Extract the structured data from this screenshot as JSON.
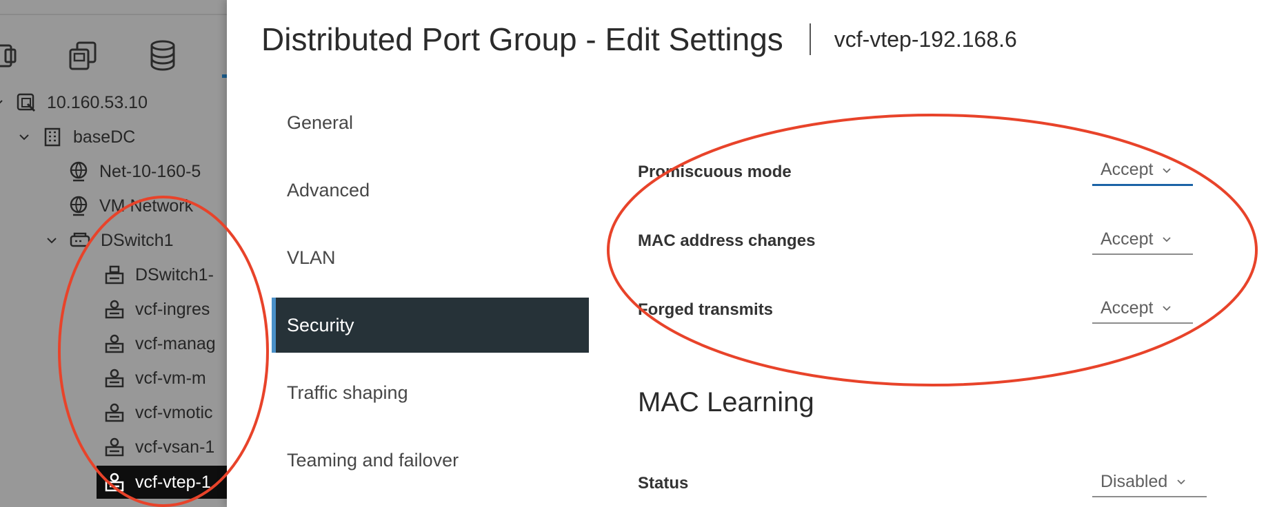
{
  "inventory": {
    "toolbar": [
      {
        "icon": "vms-templates-icon"
      },
      {
        "icon": "copy-icon"
      },
      {
        "icon": "database-icon"
      }
    ],
    "tree": [
      {
        "label": "10.160.53.10",
        "icon": "vcenter-icon",
        "expanded": true
      },
      {
        "label": "baseDC",
        "icon": "datacenter-icon",
        "expanded": true
      },
      {
        "label": "Net-10-160-5",
        "icon": "network-icon"
      },
      {
        "label": "VM Network",
        "icon": "network-icon"
      },
      {
        "label": "DSwitch1",
        "icon": "distributed-switch-icon",
        "expanded": true
      },
      {
        "label": "DSwitch1-",
        "icon": "uplink-portgroup-icon"
      },
      {
        "label": "vcf-ingres",
        "icon": "portgroup-icon"
      },
      {
        "label": "vcf-manag",
        "icon": "portgroup-icon"
      },
      {
        "label": "vcf-vm-m",
        "icon": "portgroup-icon"
      },
      {
        "label": "vcf-vmotic",
        "icon": "portgroup-icon"
      },
      {
        "label": "vcf-vsan-1",
        "icon": "portgroup-icon"
      },
      {
        "label": "vcf-vtep-1",
        "icon": "portgroup-icon",
        "selected": true
      }
    ]
  },
  "modal": {
    "title": "Distributed Port Group - Edit Settings",
    "subtitle": "vcf-vtep-192.168.6",
    "nav": [
      {
        "label": "General",
        "active": false
      },
      {
        "label": "Advanced",
        "active": false
      },
      {
        "label": "VLAN",
        "active": false
      },
      {
        "label": "Security",
        "active": true
      },
      {
        "label": "Traffic shaping",
        "active": false
      },
      {
        "label": "Teaming and failover",
        "active": false
      }
    ],
    "security": {
      "promiscuous_mode": {
        "label": "Promiscuous mode",
        "value": "Accept"
      },
      "mac_address_changes": {
        "label": "MAC address changes",
        "value": "Accept"
      },
      "forged_transmits": {
        "label": "Forged transmits",
        "value": "Accept"
      }
    },
    "mac_learning": {
      "heading": "MAC Learning",
      "status": {
        "label": "Status",
        "value": "Disabled"
      }
    }
  },
  "colors": {
    "nav_active_bg": "#263238",
    "nav_active_accent": "#4a90c8",
    "focus_underline": "#1b63a6",
    "annotation": "#e8432a",
    "overlay": "#989898"
  }
}
